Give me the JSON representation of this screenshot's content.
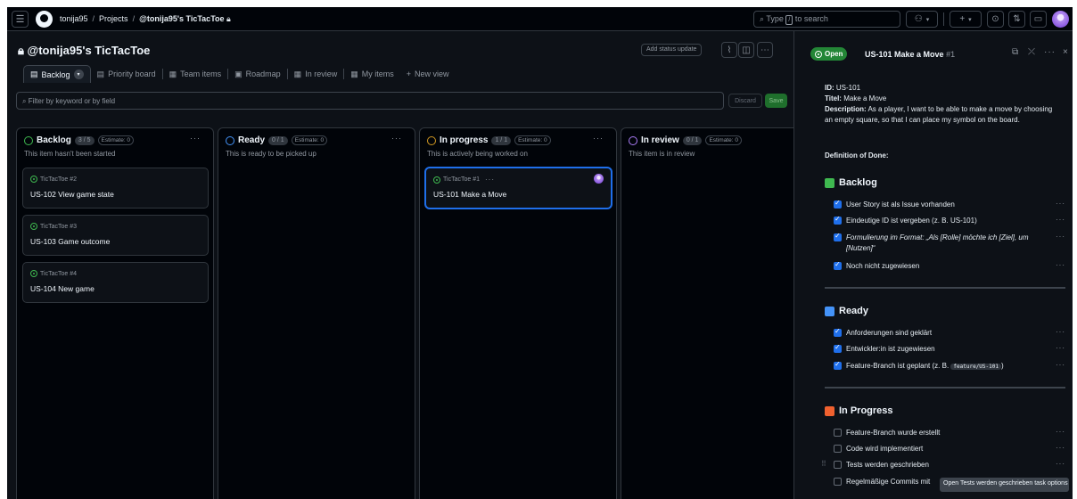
{
  "topbar": {
    "owner": "tonija95",
    "projects": "Projects",
    "project": "@tonija95's TicTacToe",
    "search_type": "Type",
    "search_key": "/",
    "search_rest": "to search"
  },
  "project": {
    "title": "@tonija95's TicTacToe",
    "add_status": "Add status update",
    "tabs": [
      {
        "label": "Backlog"
      },
      {
        "label": "Priority board"
      },
      {
        "label": "Team items"
      },
      {
        "label": "Roadmap"
      },
      {
        "label": "In review"
      },
      {
        "label": "My items"
      },
      {
        "label": "New view"
      }
    ],
    "filter_placeholder": "Filter by keyword or by field",
    "discard": "Discard",
    "save": "Save"
  },
  "columns": [
    {
      "name": "Backlog",
      "count": "3 / 5",
      "estimate": "Estimate: 0",
      "desc": "This item hasn't been started",
      "color": "#3fb950"
    },
    {
      "name": "Ready",
      "count": "0 / 1",
      "estimate": "Estimate: 0",
      "desc": "This is ready to be picked up",
      "color": "#4493f8"
    },
    {
      "name": "In progress",
      "count": "1 / 1",
      "estimate": "Estimate: 0",
      "desc": "This is actively being worked on",
      "color": "#d29922"
    },
    {
      "name": "In review",
      "count": "0 / 1",
      "estimate": "Estimate: 0",
      "desc": "This item is in review",
      "color": "#ab7df8"
    }
  ],
  "cards": [
    {
      "repo": "TicTacToe #2",
      "title": "US-102 View game state"
    },
    {
      "repo": "TicTacToe #3",
      "title": "US-103 Game outcome"
    },
    {
      "repo": "TicTacToe #4",
      "title": "US-104 New game"
    },
    {
      "repo": "TicTacToe #1",
      "title": "US-101 Make a Move"
    }
  ],
  "panel": {
    "status": "Open",
    "title": "US-101 Make a Move",
    "number": "#1",
    "id_label": "ID:",
    "id_value": "US-101",
    "titel_label": "Titel:",
    "titel_value": "Make a Move",
    "desc_label": "Description:",
    "desc_value": "As a player, I want to be able to make a move by choosing an empty square, so that I can place my symbol on the board.",
    "dod": "Definition of Done:",
    "sections": [
      {
        "title": "Backlog",
        "color": "#3fb950"
      },
      {
        "title": "Ready",
        "color": "#4493f8"
      },
      {
        "title": "In Progress",
        "color": "#f0612f"
      }
    ],
    "tasks_backlog": [
      "User Story ist als Issue vorhanden",
      "Eindeutige ID ist vergeben (z. B. US-101)",
      "Formulierung im Format: „Als [Rolle] möchte ich [Ziel], um [Nutzen]“",
      "Noch nicht zugewiesen"
    ],
    "tasks_ready": [
      "Anforderungen sind geklärt",
      "Entwickler:in ist zugewiesen",
      "Feature-Branch ist geplant (z. B.",
      "feature/US-101",
      ")"
    ],
    "tasks_progress": [
      "Feature-Branch wurde erstellt",
      "Code wird implementiert",
      "Tests werden geschrieben",
      "Regelmäßige Commits mit"
    ],
    "tooltip": "Open Tests werden geschrieben task options"
  }
}
